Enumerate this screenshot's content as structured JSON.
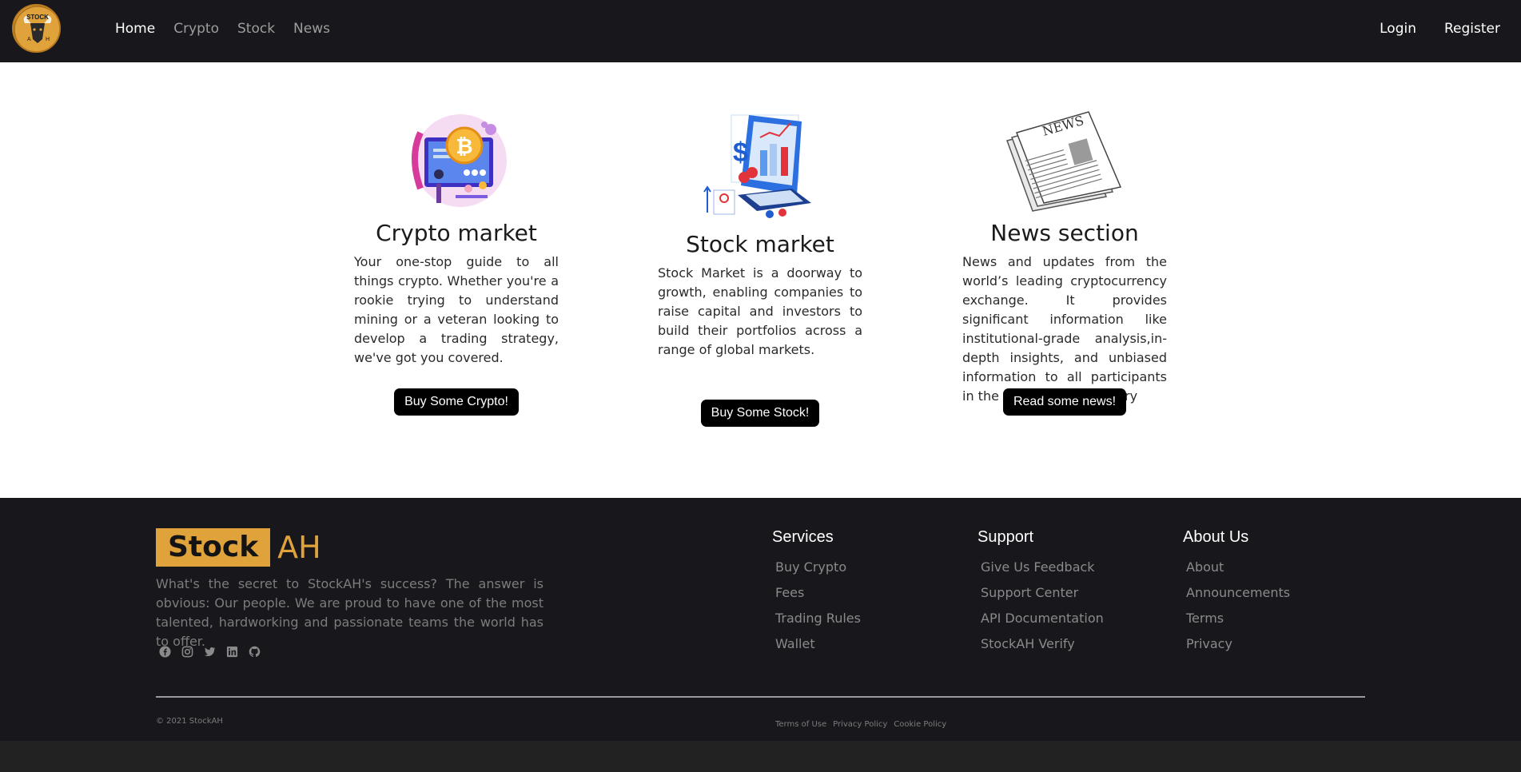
{
  "brand_colors": {
    "accent": "#e0a23a",
    "dark": "#18171c"
  },
  "nav": {
    "logo_text": "STOCK",
    "logo_sub_left": "A",
    "logo_sub_right": "H",
    "links": [
      "Home",
      "Crypto",
      "Stock",
      "News"
    ],
    "active": "Home",
    "login": "Login",
    "register": "Register"
  },
  "cards": [
    {
      "title": "Crypto market",
      "text": "Your one-stop guide to all things crypto. Whether you're a rookie trying to understand mining or a veteran looking to develop a trading strategy, we've got you covered.",
      "button": "Buy Some Crypto!",
      "illustration": "crypto-illustration"
    },
    {
      "title": "Stock market",
      "text": "Stock Market is a doorway to growth, enabling companies to raise capital and investors to build their portfolios across a range of global markets.",
      "button": "Buy Some Stock!",
      "illustration": "stock-illustration"
    },
    {
      "title": "News section",
      "text": "News and updates from the world’s leading cryptocurrency exchange. It provides significant information like institutional-grade analysis,in-depth insights, and unbiased information to all participants in the digital asset industry",
      "button": "Read some news!",
      "illustration": "newspaper-illustration"
    }
  ],
  "footer": {
    "brand_box": "Stock",
    "brand_rest": "AH",
    "about": "What's the secret to StockAH's success? The answer is obvious: Our people. We are proud to have one of the most talented, hardworking and passionate teams the world has to offer.",
    "socials": [
      "facebook-icon",
      "instagram-icon",
      "twitter-icon",
      "linkedin-icon",
      "github-icon"
    ],
    "columns": [
      {
        "title": "Services",
        "items": [
          "Buy Crypto",
          "Fees",
          "Trading Rules",
          "Wallet"
        ]
      },
      {
        "title": "Support",
        "items": [
          "Give Us Feedback",
          "Support Center",
          "API Documentation",
          "StockAH Verify"
        ]
      },
      {
        "title": "About Us",
        "items": [
          "About",
          "Announcements",
          "Terms",
          "Privacy"
        ]
      }
    ],
    "copyright": "© 2021 StockAH",
    "legal": [
      "Terms of Use",
      "Privacy Policy",
      "Cookie Policy"
    ]
  }
}
